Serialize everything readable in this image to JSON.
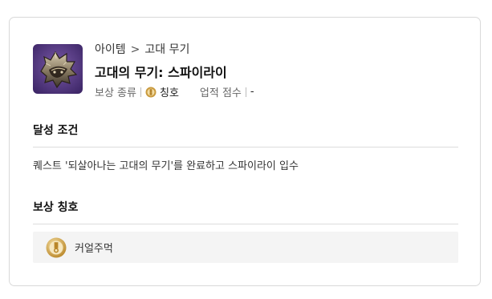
{
  "breadcrumb": {
    "category": "아이템",
    "separator": ">",
    "subcategory": "고대 무기"
  },
  "title": "고대의 무기: 스파이라이",
  "meta": {
    "reward_type_label": "보상 종류",
    "reward_type_value": "칭호",
    "score_label": "업적 점수",
    "score_value": "-"
  },
  "condition": {
    "heading": "달성 조건",
    "text": "퀘스트 '되살아나는 고대의 무기'를 완료하고 스파이라이 입수"
  },
  "reward": {
    "heading": "보상 칭호",
    "title_name": "커얼주먹"
  },
  "icons": {
    "item": "spiked-helmet-icon",
    "reward_type": "medal-icon",
    "reward": "medal-icon"
  },
  "colors": {
    "item_background": "#5b3f8c",
    "medal_gold": "#c99a3e",
    "reward_box": "#f4f4f4"
  }
}
